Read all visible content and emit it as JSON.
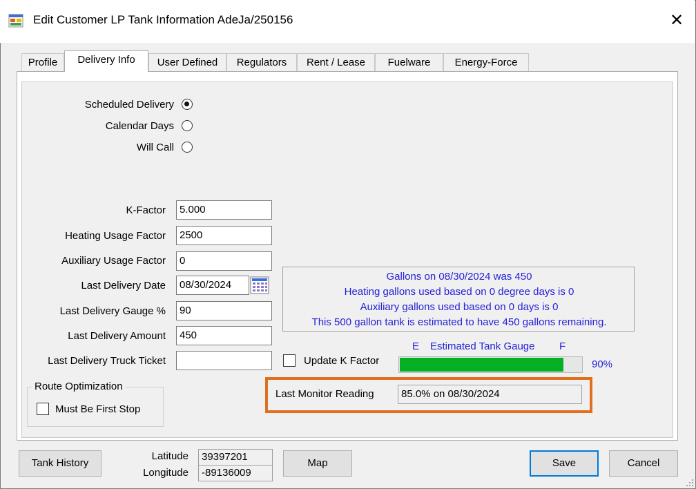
{
  "window": {
    "title": "Edit Customer LP Tank Information AdeJa/250156",
    "close_glyph": "✕"
  },
  "tabs": [
    {
      "label": "Profile",
      "active": false
    },
    {
      "label": "Delivery Info",
      "active": true
    },
    {
      "label": "User Defined",
      "active": false
    },
    {
      "label": "Regulators",
      "active": false
    },
    {
      "label": "Rent / Lease",
      "active": false
    },
    {
      "label": "Fuelware",
      "active": false
    },
    {
      "label": "Energy-Force",
      "active": false
    }
  ],
  "delivery_type": {
    "options": [
      {
        "label": "Scheduled Delivery",
        "selected": true
      },
      {
        "label": "Calendar Days",
        "selected": false
      },
      {
        "label": "Will Call",
        "selected": false
      }
    ]
  },
  "fields": {
    "k_factor": {
      "label": "K-Factor",
      "value": "5.000"
    },
    "heating_usage_factor": {
      "label": "Heating Usage Factor",
      "value": "2500"
    },
    "auxiliary_usage_factor": {
      "label": "Auxiliary Usage Factor",
      "value": "0"
    },
    "last_delivery_date": {
      "label": "Last Delivery Date",
      "value": "08/30/2024"
    },
    "last_delivery_gauge": {
      "label": "Last Delivery Gauge %",
      "value": "90"
    },
    "last_delivery_amount": {
      "label": "Last Delivery Amount",
      "value": "450"
    },
    "last_delivery_truck_ticket": {
      "label": "Last Delivery Truck Ticket",
      "value": ""
    }
  },
  "info": {
    "lines": [
      "Gallons on 08/30/2024 was 450",
      "Heating gallons used based on 0 degree days is 0",
      "Auxiliary gallons used based on 0 days is 0",
      "This 500 gallon tank is estimated to have 450 gallons remaining."
    ],
    "color": "#2420d8"
  },
  "update_k_factor": {
    "label": "Update K Factor",
    "checked": false
  },
  "gauge": {
    "empty_label": "E",
    "title": "Estimated Tank Gauge",
    "full_label": "F",
    "percent": 90,
    "percent_text": "90%",
    "fill_color": "#06b025"
  },
  "monitor": {
    "label": "Last Monitor Reading",
    "value": "85.0% on 08/30/2024",
    "highlight_color": "#e07020"
  },
  "route_optimization": {
    "legend": "Route Optimization",
    "must_be_first_stop": {
      "label": "Must Be First Stop",
      "checked": false
    }
  },
  "footer": {
    "tank_history_label": "Tank History",
    "latitude_label": "Latitude",
    "latitude_value": "39397201",
    "longitude_label": "Longitude",
    "longitude_value": "-89136009",
    "map_label": "Map",
    "save_label": "Save",
    "cancel_label": "Cancel"
  }
}
